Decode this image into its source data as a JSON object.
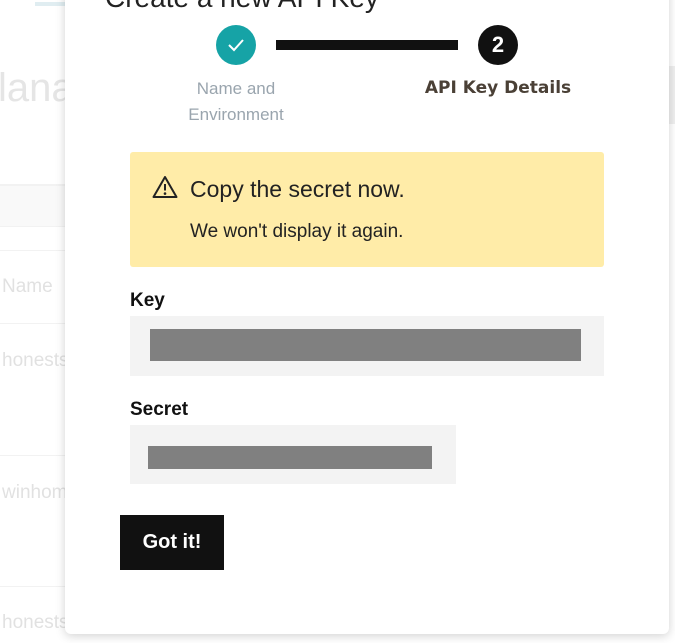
{
  "background": {
    "heading_fragment": "lana",
    "column_header_fragment": "Name",
    "rows": [
      "honests",
      "winhom",
      "honests"
    ]
  },
  "modal": {
    "title": "Create a new API Key",
    "steps": [
      {
        "label": "Name and Environment",
        "state": "done",
        "icon": "checkmark-icon"
      },
      {
        "number": "2",
        "label": "API Key Details",
        "state": "current"
      }
    ],
    "warning": {
      "icon": "warning-triangle-icon",
      "title": "Copy the secret now.",
      "body": "We won't display it again."
    },
    "key": {
      "label": "Key",
      "value_state": "redacted"
    },
    "secret": {
      "label": "Secret",
      "value_state": "redacted"
    },
    "confirm_button": "Got it!"
  },
  "colors": {
    "step_done": "#16a3a6",
    "step_current": "#111111",
    "warning_bg": "#ffeca8",
    "field_bg": "#f3f3f3",
    "redaction": "#808080",
    "button_bg": "#111111"
  }
}
